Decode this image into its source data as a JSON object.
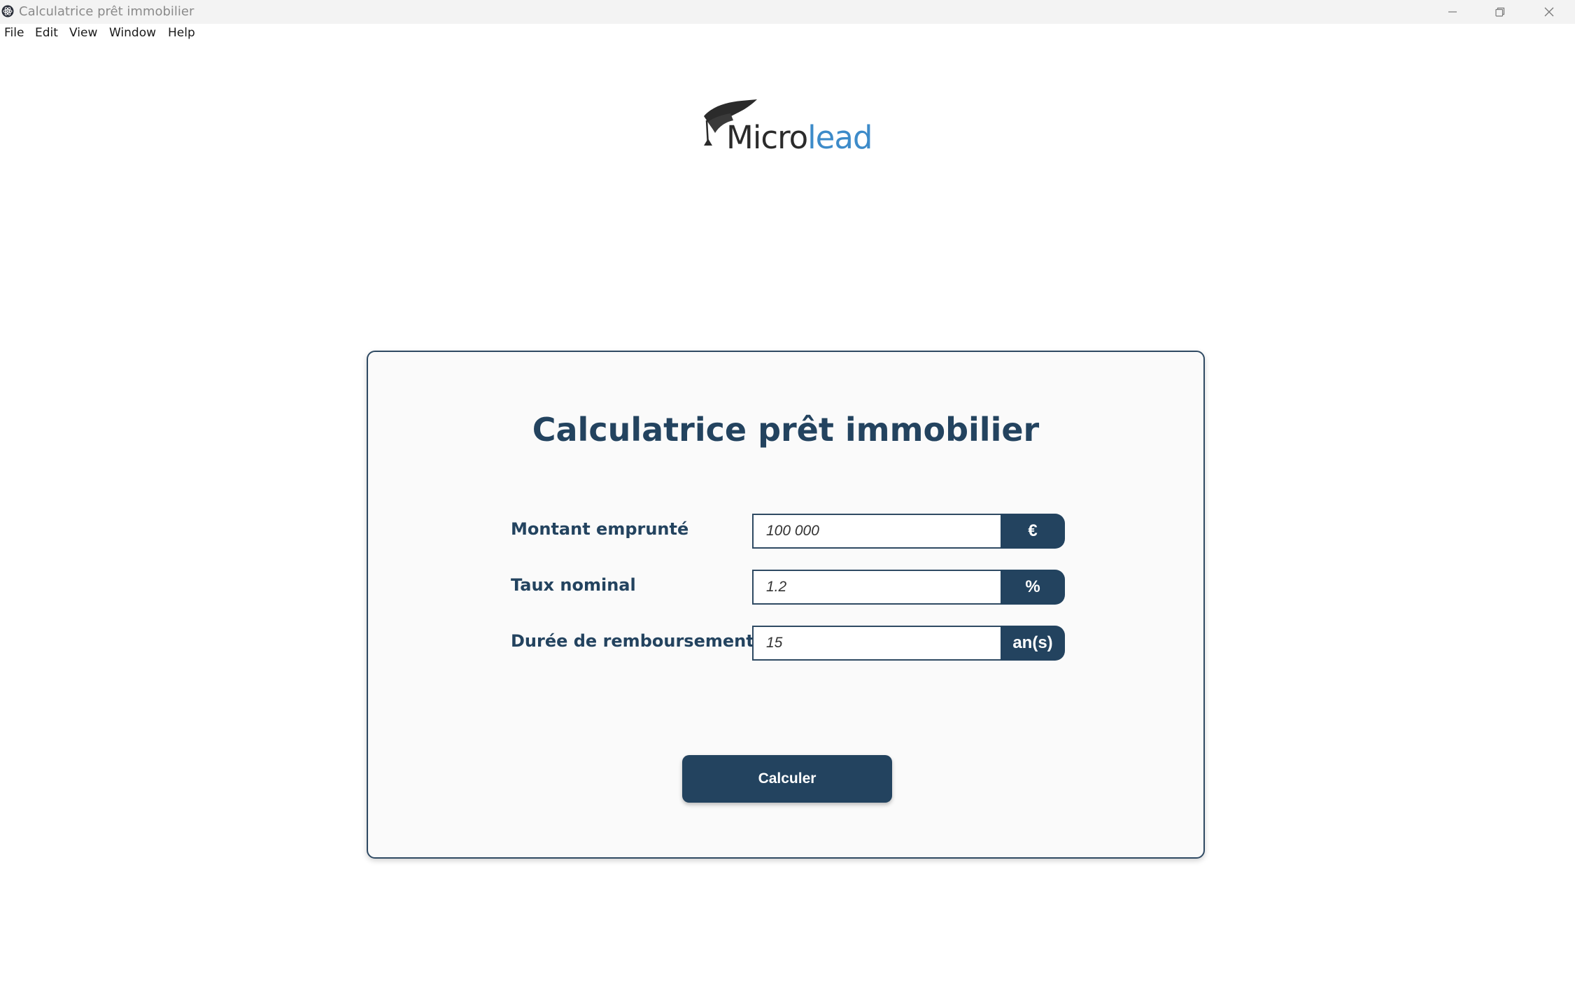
{
  "window": {
    "title": "Calculatrice prêt immobilier",
    "app_icon": "electron-atom-icon",
    "controls": [
      "minimize-icon",
      "restore-icon",
      "close-icon"
    ]
  },
  "menu": {
    "items": [
      "File",
      "Edit",
      "View",
      "Window",
      "Help"
    ]
  },
  "logo": {
    "text_dark": "Micro",
    "text_blue": "lead",
    "icon": "graduation-cap-icon"
  },
  "form": {
    "title": "Calculatrice prêt immobilier",
    "fields": [
      {
        "label": "Montant emprunté",
        "value": "100 000",
        "unit": "€"
      },
      {
        "label": "Taux nominal",
        "value": "1.2",
        "unit": "%"
      },
      {
        "label": "Durée de remboursement",
        "value": "15",
        "unit": "an(s)"
      }
    ],
    "submit_label": "Calculer"
  },
  "colors": {
    "primary": "#23435f",
    "logo_blue": "#3d8bc9",
    "card_background": "#fafafa",
    "titlebar": "#f3f3f3"
  }
}
